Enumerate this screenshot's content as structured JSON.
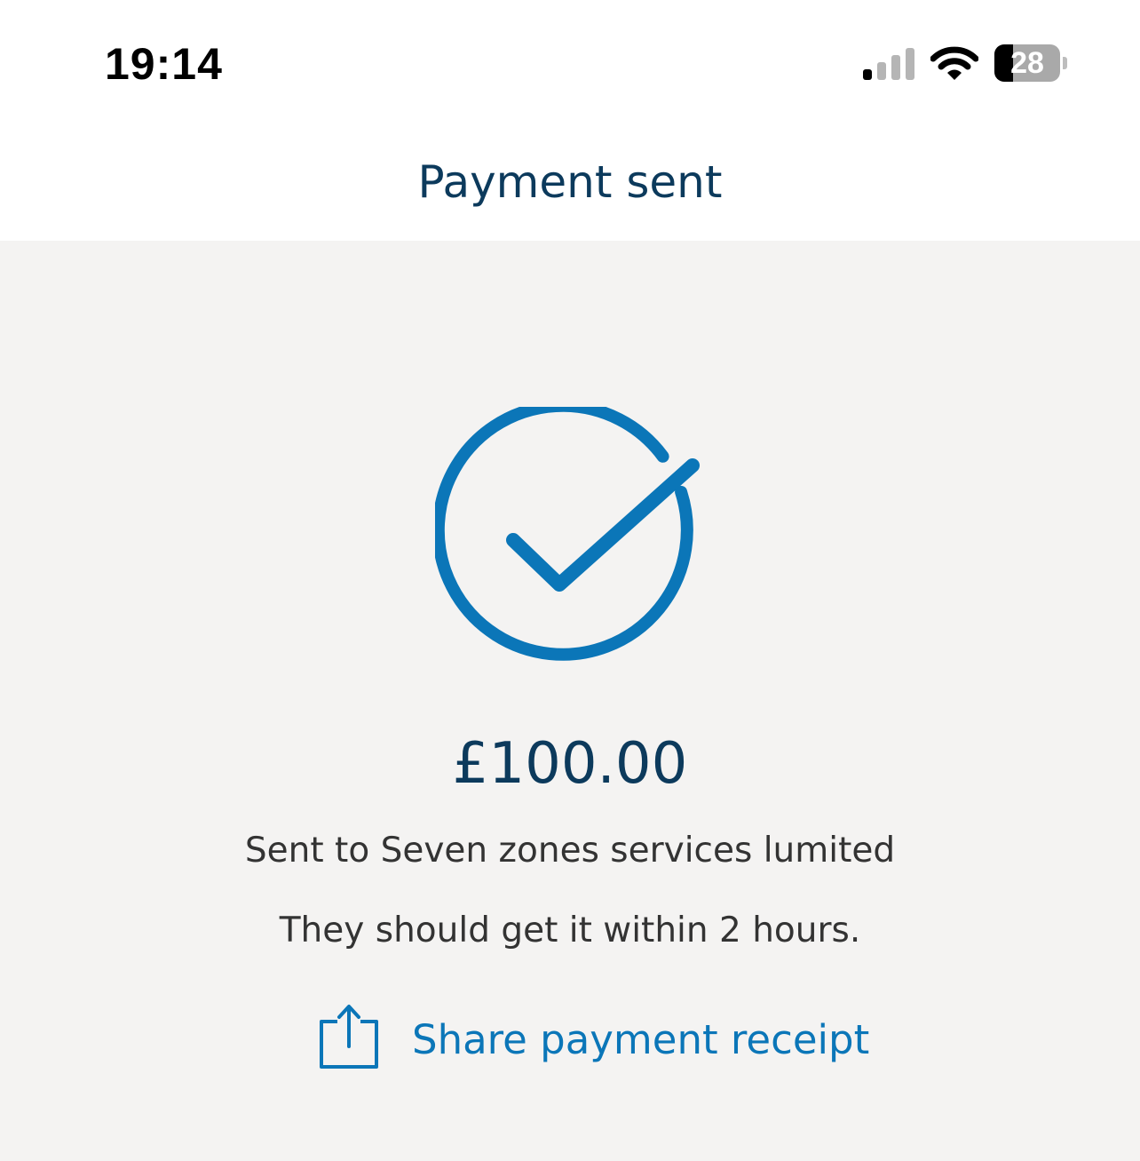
{
  "status_bar": {
    "time": "19:14",
    "battery_level": "28",
    "battery_fraction": 0.28,
    "signal_bars_active": 1,
    "signal_bars_total": 4
  },
  "header": {
    "title": "Payment sent"
  },
  "confirmation": {
    "icon": "check-circle-icon",
    "amount": "£100.00",
    "recipient_line": "Sent to Seven zones services lumited",
    "eta_line": "They should get it within 2 hours."
  },
  "actions": {
    "share_icon": "share-icon",
    "share_label": "Share payment receipt"
  },
  "colors": {
    "accent": "#0b76b8",
    "title_text": "#0c3a5c",
    "body_text": "#333333",
    "background": "#f4f3f2",
    "header_background": "#ffffff"
  }
}
